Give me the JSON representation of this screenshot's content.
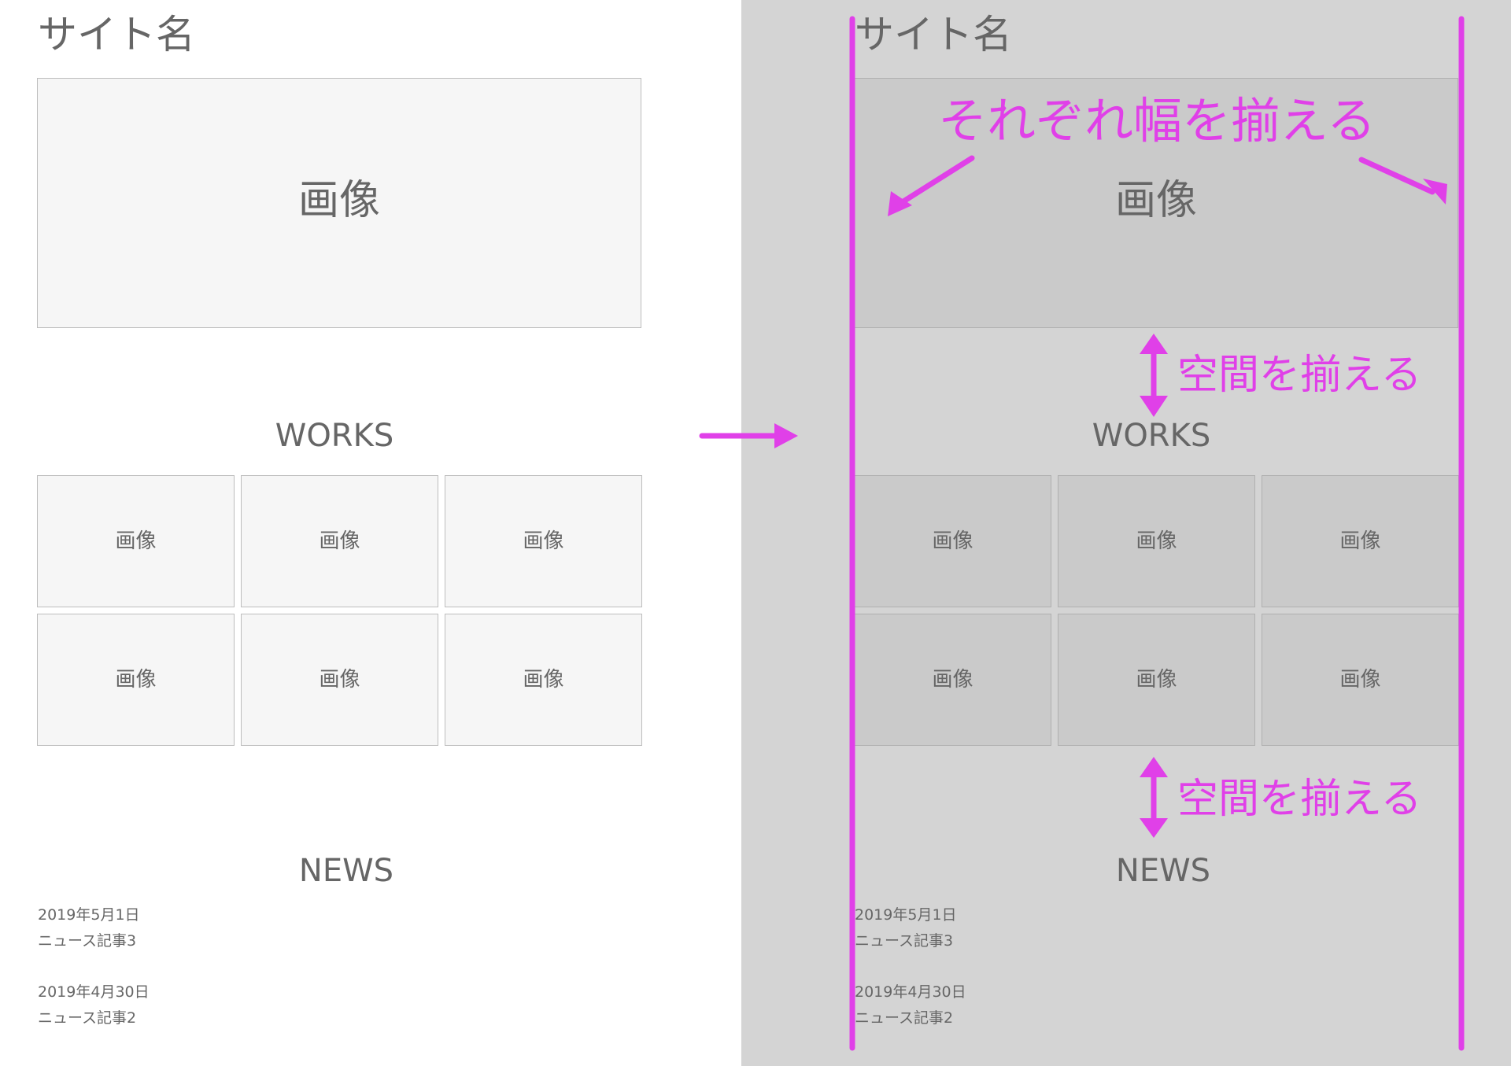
{
  "site_name": "サイト名",
  "hero_label": "画像",
  "works_title": "WORKS",
  "tile_label": "画像",
  "news_title": "NEWS",
  "news": [
    {
      "date": "2019年5月1日",
      "title": "ニュース記事3"
    },
    {
      "date": "2019年4月30日",
      "title": "ニュース記事2"
    }
  ],
  "annotations": {
    "align_widths": "それぞれ幅を揃える",
    "align_spacing": "空間を揃える"
  },
  "colors": {
    "annotation": "#e040e8",
    "right_panel_bg": "#d4d4d4",
    "placeholder_left": "#f6f6f6",
    "placeholder_right": "#cacaca",
    "text": "#666666"
  }
}
